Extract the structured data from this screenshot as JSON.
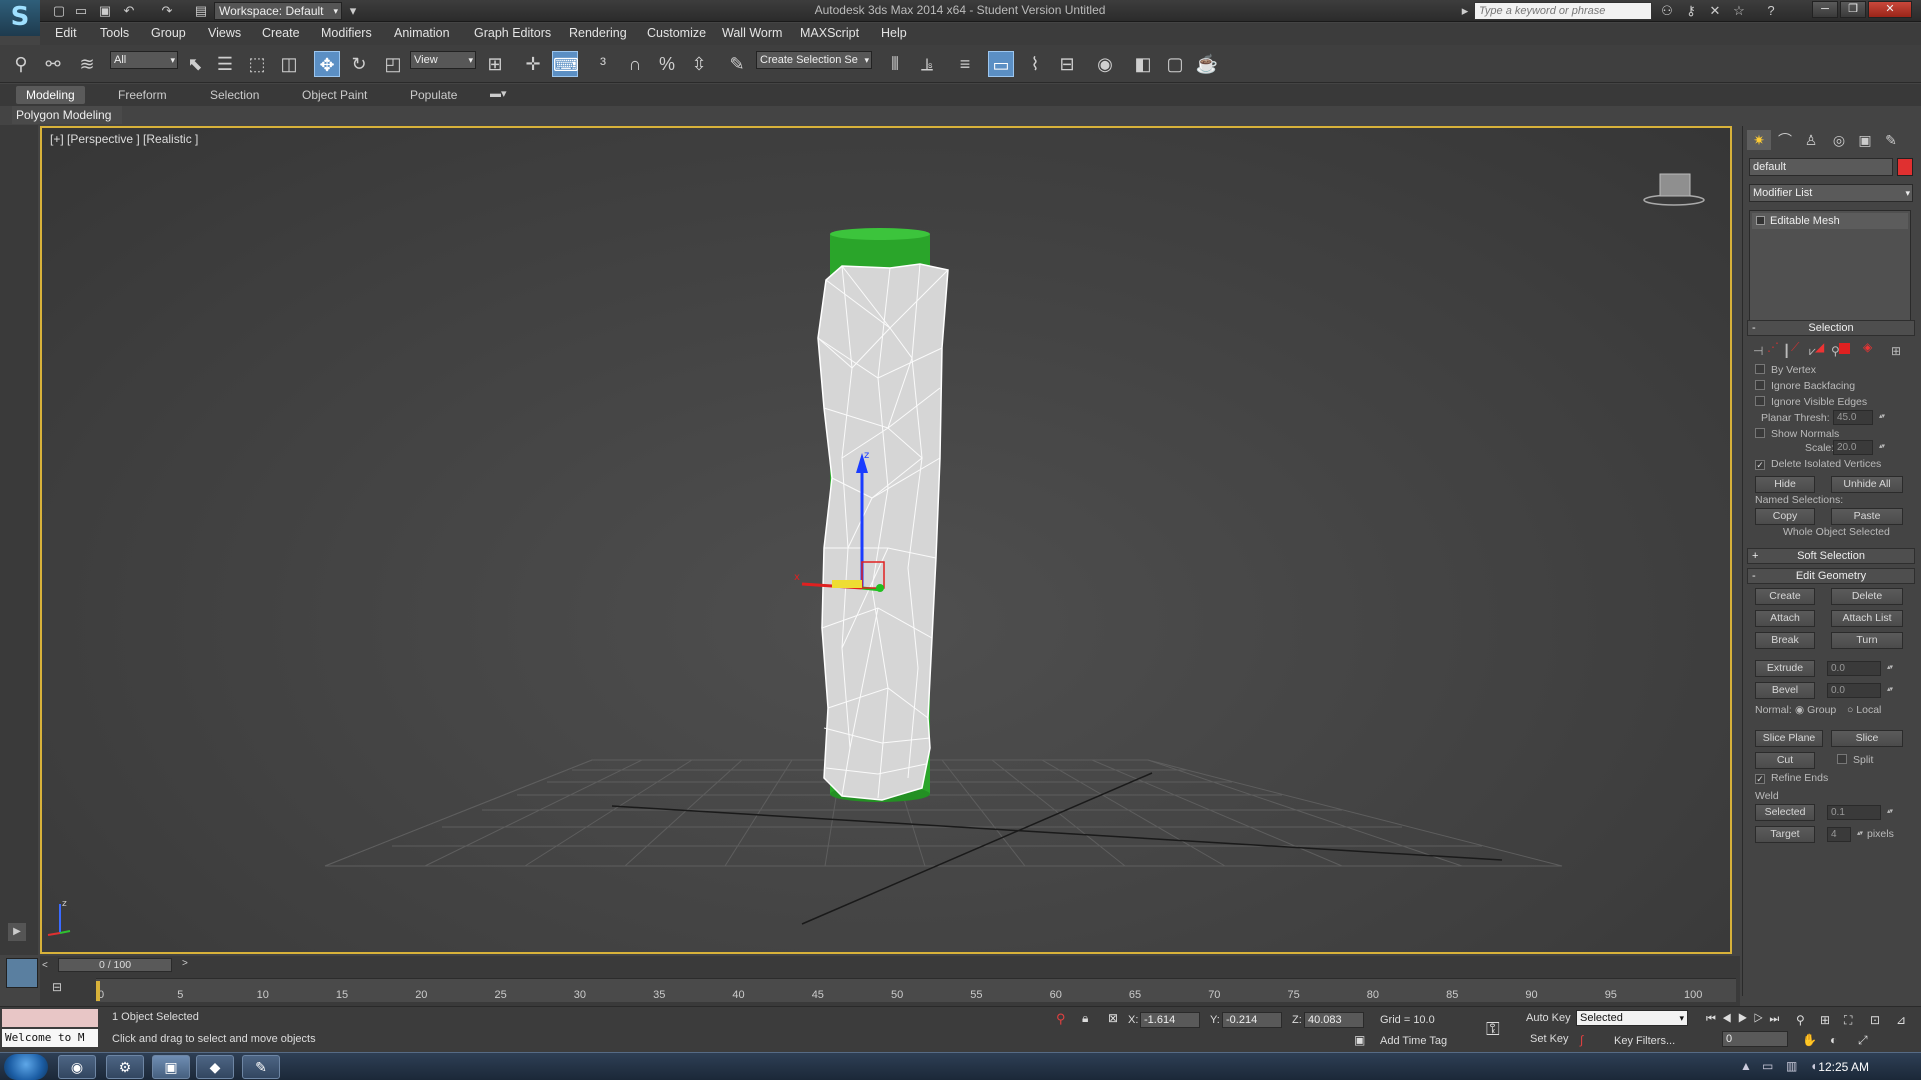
{
  "window": {
    "title": "Autodesk 3ds Max  2014 x64  -  Student Version    Untitled",
    "workspace": "Workspace: Default",
    "search_placeholder": "Type a keyword or phrase"
  },
  "menu": [
    "Edit",
    "Tools",
    "Group",
    "Views",
    "Create",
    "Modifiers",
    "Animation",
    "Graph Editors",
    "Rendering",
    "Customize",
    "Wall Worm",
    "MAXScript",
    "Help"
  ],
  "toolbar": {
    "selection_filter": "All",
    "ref_coord": "View",
    "named_selection": "Create Selection Se"
  },
  "ribbon": {
    "tabs": [
      "Modeling",
      "Freeform",
      "Selection",
      "Object Paint",
      "Populate"
    ],
    "active_tab": "Modeling",
    "panel_label": "Polygon Modeling"
  },
  "viewport": {
    "label": "[+] [Perspective ] [Realistic ]"
  },
  "command_panel": {
    "object_name": "default",
    "object_color": "#e03030",
    "modifier_list": "Modifier List",
    "stack_item": "Editable Mesh",
    "selection_rollout": {
      "title": "Selection",
      "by_vertex": "By Vertex",
      "ignore_backfacing": "Ignore Backfacing",
      "ignore_visible_edges": "Ignore Visible Edges",
      "planar_thresh_label": "Planar Thresh:",
      "planar_thresh": "45.0",
      "show_normals": "Show Normals",
      "scale_label": "Scale:",
      "scale": "20.0",
      "delete_isolated": "Delete Isolated Vertices",
      "hide": "Hide",
      "unhide_all": "Unhide All",
      "named_selections": "Named Selections:",
      "copy": "Copy",
      "paste": "Paste",
      "status": "Whole Object Selected"
    },
    "soft_selection": "Soft Selection",
    "edit_geometry": {
      "title": "Edit Geometry",
      "create": "Create",
      "delete": "Delete",
      "attach": "Attach",
      "attach_list": "Attach List",
      "break": "Break",
      "turn": "Turn",
      "extrude": "Extrude",
      "extrude_val": "0.0",
      "bevel": "Bevel",
      "bevel_val": "0.0",
      "normal_label": "Normal:",
      "group": "Group",
      "local": "Local",
      "slice_plane": "Slice Plane",
      "slice": "Slice",
      "cut": "Cut",
      "split": "Split",
      "refine_ends": "Refine Ends",
      "weld": "Weld",
      "selected": "Selected",
      "selected_val": "0.1",
      "target": "Target",
      "target_val": "4",
      "pixels": "pixels"
    }
  },
  "timeline": {
    "slider": "0 / 100",
    "ticks": [
      "0",
      "5",
      "10",
      "15",
      "20",
      "25",
      "30",
      "35",
      "40",
      "45",
      "50",
      "55",
      "60",
      "65",
      "70",
      "75",
      "80",
      "85",
      "90",
      "95",
      "100"
    ]
  },
  "status": {
    "listener": "Welcome to M",
    "objects_selected": "1 Object Selected",
    "prompt": "Click and drag to select and move objects",
    "x_label": "X:",
    "x": "-1.614",
    "y_label": "Y:",
    "y": "-0.214",
    "z_label": "Z:",
    "z": "40.083",
    "grid": "Grid = 10.0",
    "add_time_tag": "Add Time Tag",
    "auto_key": "Auto Key",
    "set_key": "Set Key",
    "key_mode": "Selected",
    "key_filters": "Key Filters...",
    "frame": "0"
  },
  "taskbar": {
    "clock": "12:25 AM"
  }
}
